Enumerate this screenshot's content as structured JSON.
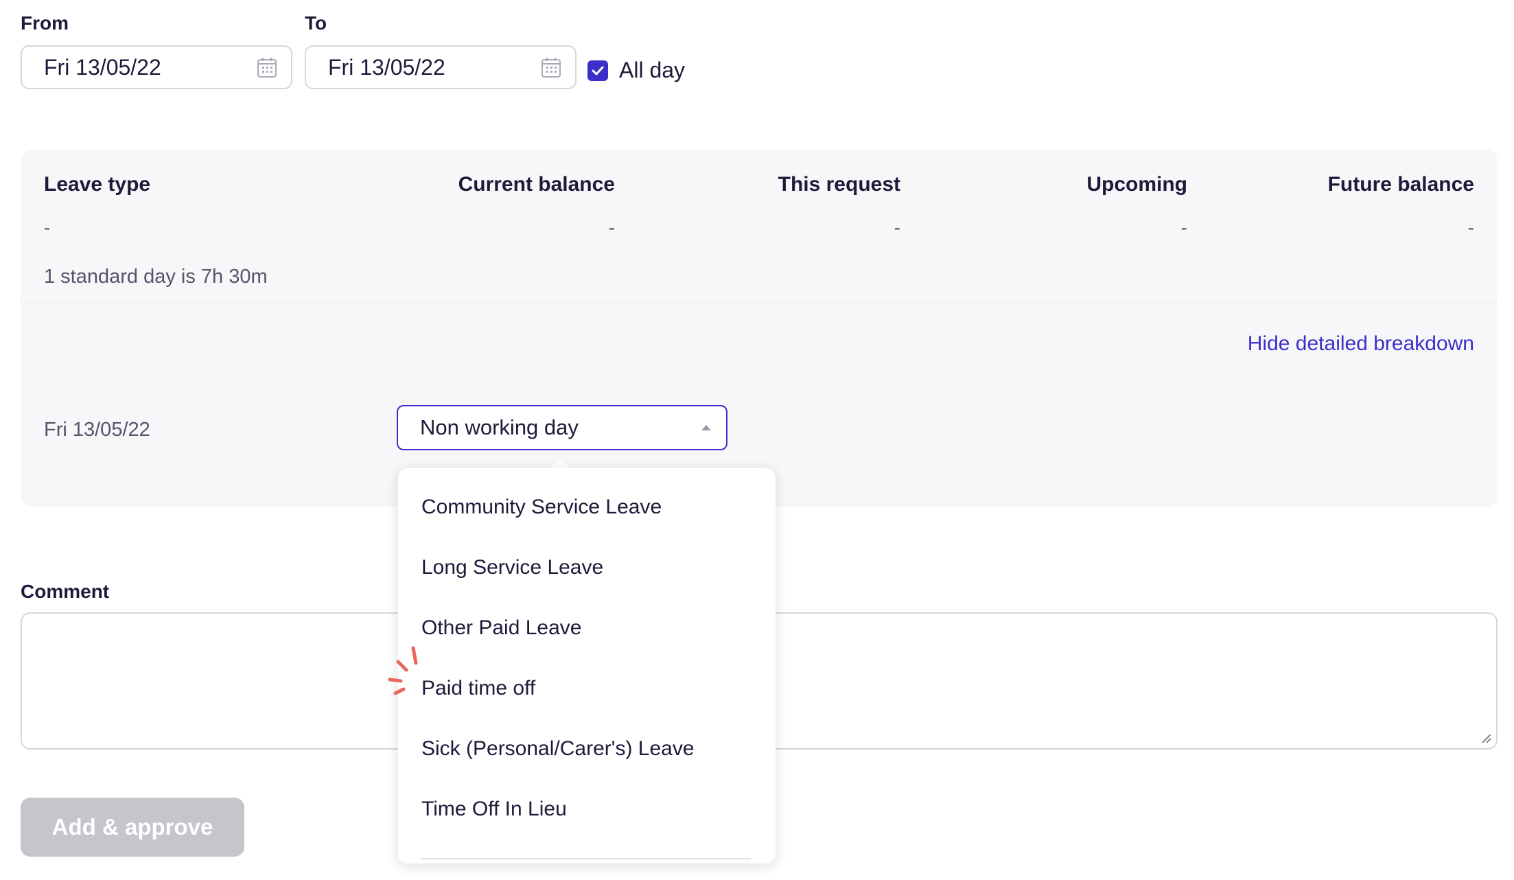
{
  "form": {
    "from_label": "From",
    "to_label": "To",
    "from_value": "Fri 13/05/22",
    "to_value": "Fri 13/05/22",
    "all_day_label": "All day",
    "all_day_checked": true
  },
  "balance_table": {
    "headers": [
      "Leave type",
      "Current balance",
      "This request",
      "Upcoming",
      "Future balance"
    ],
    "values": [
      "-",
      "-",
      "-",
      "-",
      "-"
    ],
    "standard_day_note": "1 standard day is 7h 30m",
    "hide_breakdown_label": "Hide detailed breakdown",
    "breakdown_rows": [
      {
        "date": "Fri 13/05/22",
        "selected_type": "Non working day"
      }
    ]
  },
  "dropdown": {
    "options": [
      "Community Service Leave",
      "Long Service Leave",
      "Other Paid Leave",
      "Paid time off",
      "Sick (Personal/Carer's) Leave",
      "Time Off In Lieu"
    ]
  },
  "comment": {
    "label": "Comment",
    "value": ""
  },
  "actions": {
    "submit_label": "Add & approve",
    "submit_disabled": true
  },
  "colors": {
    "accent": "#3b2fc9",
    "disabled_button": "#c5c5cc",
    "panel_bg": "#f7f7f9",
    "click_marker": "#e8685e"
  }
}
